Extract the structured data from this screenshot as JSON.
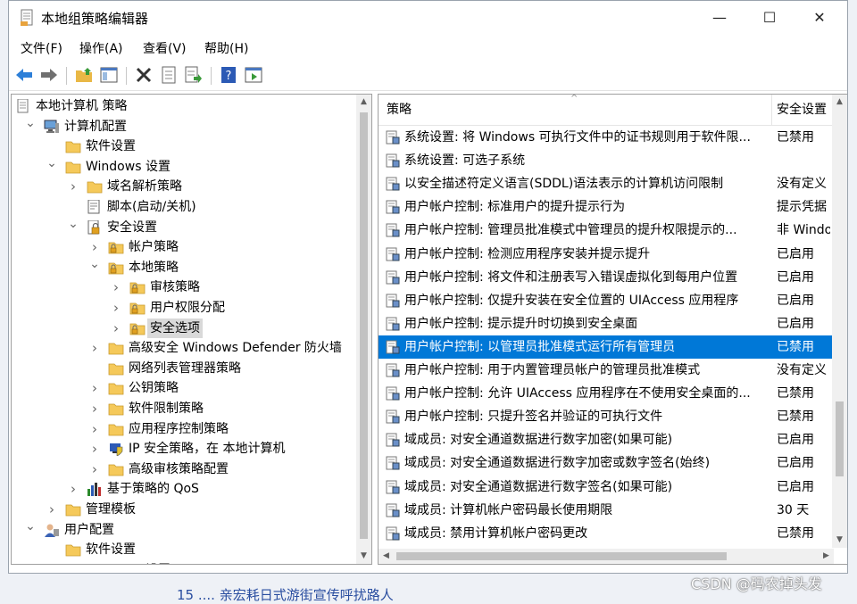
{
  "window": {
    "title": "本地组策略编辑器",
    "minimize": "—",
    "maximize": "☐",
    "close": "✕"
  },
  "menu": [
    "文件(F)",
    "操作(A)",
    "查看(V)",
    "帮助(H)"
  ],
  "toolbar": [
    "back-arrow-icon",
    "forward-arrow-icon",
    "up-folder-icon",
    "show-hide-tree-icon",
    "delete-icon",
    "properties-icon",
    "export-list-icon",
    "help-icon",
    "filter-view-icon"
  ],
  "tree": [
    {
      "label": "本地计算机 策略",
      "level": 0,
      "icon": "policy-doc",
      "chev": ""
    },
    {
      "label": "计算机配置",
      "level": 1,
      "icon": "computer",
      "chev": "expanded"
    },
    {
      "label": "软件设置",
      "level": 2,
      "icon": "folder",
      "chev": ""
    },
    {
      "label": "Windows 设置",
      "level": 2,
      "icon": "folder",
      "chev": "expanded"
    },
    {
      "label": "域名解析策略",
      "level": 3,
      "icon": "folder",
      "chev": "collapsed"
    },
    {
      "label": "脚本(启动/关机)",
      "level": 3,
      "icon": "script",
      "chev": ""
    },
    {
      "label": "安全设置",
      "level": 3,
      "icon": "security",
      "chev": "expanded"
    },
    {
      "label": "帐户策略",
      "level": 4,
      "icon": "lock-folder",
      "chev": "collapsed"
    },
    {
      "label": "本地策略",
      "level": 4,
      "icon": "lock-folder",
      "chev": "expanded"
    },
    {
      "label": "审核策略",
      "level": 5,
      "icon": "lock-folder",
      "chev": "collapsed"
    },
    {
      "label": "用户权限分配",
      "level": 5,
      "icon": "lock-folder",
      "chev": "collapsed"
    },
    {
      "label": "安全选项",
      "level": 5,
      "icon": "lock-folder",
      "chev": "collapsed",
      "selected": true
    },
    {
      "label": "高级安全 Windows Defender 防火墙",
      "level": 4,
      "icon": "folder",
      "chev": "collapsed"
    },
    {
      "label": "网络列表管理器策略",
      "level": 4,
      "icon": "folder",
      "chev": ""
    },
    {
      "label": "公钥策略",
      "level": 4,
      "icon": "folder",
      "chev": "collapsed"
    },
    {
      "label": "软件限制策略",
      "level": 4,
      "icon": "folder",
      "chev": "collapsed"
    },
    {
      "label": "应用程序控制策略",
      "level": 4,
      "icon": "folder",
      "chev": "collapsed"
    },
    {
      "label": "IP 安全策略，在 本地计算机",
      "level": 4,
      "icon": "ip-shield",
      "chev": "collapsed"
    },
    {
      "label": "高级审核策略配置",
      "level": 4,
      "icon": "folder",
      "chev": "collapsed"
    },
    {
      "label": "基于策略的 QoS",
      "level": 3,
      "icon": "bar-chart",
      "chev": "collapsed"
    },
    {
      "label": "管理模板",
      "level": 2,
      "icon": "folder",
      "chev": "collapsed"
    },
    {
      "label": "用户配置",
      "level": 1,
      "icon": "user",
      "chev": "expanded"
    },
    {
      "label": "软件设置",
      "level": 2,
      "icon": "folder",
      "chev": ""
    },
    {
      "label": "Windows 设置",
      "level": 2,
      "icon": "folder",
      "chev": ""
    }
  ],
  "list": {
    "col_policy": "策略",
    "col_setting": "安全设置",
    "rows": [
      {
        "policy": "系统设置: 将 Windows 可执行文件中的证书规则用于软件限...",
        "setting": "已禁用"
      },
      {
        "policy": "系统设置: 可选子系统",
        "setting": ""
      },
      {
        "policy": "以安全描述符定义语言(SDDL)语法表示的计算机访问限制",
        "setting": "没有定义"
      },
      {
        "policy": "用户帐户控制: 标准用户的提升提示行为",
        "setting": "提示凭据"
      },
      {
        "policy": "用户帐户控制: 管理员批准模式中管理员的提升权限提示的...",
        "setting": "非 Windows"
      },
      {
        "policy": "用户帐户控制: 检测应用程序安装并提示提升",
        "setting": "已启用"
      },
      {
        "policy": "用户帐户控制: 将文件和注册表写入错误虚拟化到每用户位置",
        "setting": "已启用"
      },
      {
        "policy": "用户帐户控制: 仅提升安装在安全位置的 UIAccess 应用程序",
        "setting": "已启用"
      },
      {
        "policy": "用户帐户控制: 提示提升时切换到安全桌面",
        "setting": "已启用"
      },
      {
        "policy": "用户帐户控制: 以管理员批准模式运行所有管理员",
        "setting": "已禁用",
        "selected": true
      },
      {
        "policy": "用户帐户控制: 用于内置管理员帐户的管理员批准模式",
        "setting": "没有定义"
      },
      {
        "policy": "用户帐户控制: 允许 UIAccess 应用程序在不使用安全桌面的...",
        "setting": "已禁用"
      },
      {
        "policy": "用户帐户控制: 只提升签名并验证的可执行文件",
        "setting": "已禁用"
      },
      {
        "policy": "域成员: 对安全通道数据进行数字加密(如果可能)",
        "setting": "已启用"
      },
      {
        "policy": "域成员: 对安全通道数据进行数字加密或数字签名(始终)",
        "setting": "已启用"
      },
      {
        "policy": "域成员: 对安全通道数据进行数字签名(如果可能)",
        "setting": "已启用"
      },
      {
        "policy": "域成员: 计算机帐户密码最长使用期限",
        "setting": "30 天"
      },
      {
        "policy": "域成员: 禁用计算机帐户密码更改",
        "setting": "已禁用"
      }
    ]
  },
  "below_window_text": "15 .... 亲宏耗日式游街宣传呼扰路人",
  "watermark": "CSDN @码农掉头发",
  "colors": {
    "selection": "#0078d7",
    "folder": "#f5c95a",
    "tree_selection": "#d9d9d9"
  }
}
